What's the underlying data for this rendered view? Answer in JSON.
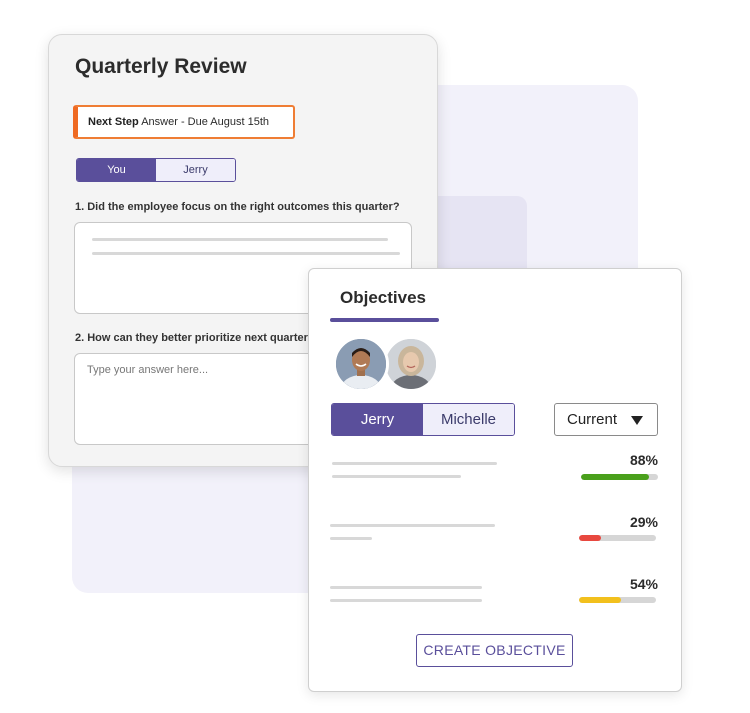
{
  "review": {
    "title": "Quarterly Review",
    "next_step_label": "Next Step",
    "next_step_text": "Answer - Due August 15th",
    "toggle": [
      "You",
      "Jerry"
    ],
    "question1": "1. Did the employee focus on the right outcomes this quarter?",
    "question2": "2. How can they better prioritize next quarter?",
    "answer2_placeholder": "Type your answer here..."
  },
  "objectives": {
    "title": "Objectives",
    "people": [
      "Jerry",
      "Michelle"
    ],
    "filter_value": "Current",
    "rows": [
      {
        "percent_label": "88%",
        "progress": 0.88,
        "color": "#4aa01c"
      },
      {
        "percent_label": "29%",
        "progress": 0.29,
        "color": "#e8483f"
      },
      {
        "percent_label": "54%",
        "progress": 0.54,
        "color": "#f2c01d"
      }
    ],
    "create_button": "CREATE OBJECTIVE"
  },
  "colors": {
    "accent": "#5a4f9b",
    "next_step_border": "#ef6a22"
  }
}
